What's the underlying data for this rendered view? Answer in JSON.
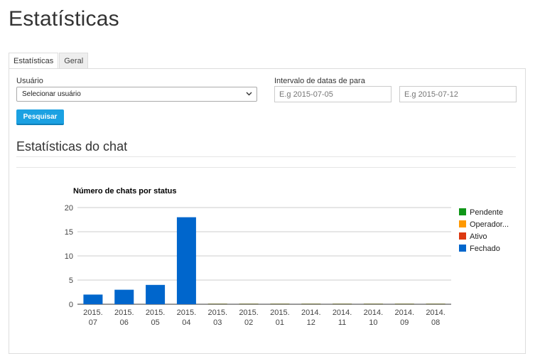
{
  "page": {
    "title": "Estatísticas"
  },
  "tabs": [
    {
      "label": "Estatísticas",
      "active": true
    },
    {
      "label": "Geral",
      "active": false
    }
  ],
  "form": {
    "user_label": "Usuário",
    "user_select_value": "Selecionar usuário",
    "date_range_label": "Intervalo de datas de para",
    "date_from_placeholder": "E.g 2015-07-05",
    "date_to_placeholder": "E.g 2015-07-12",
    "search_button": "Pesquisar"
  },
  "section": {
    "title": "Estatísticas do chat"
  },
  "colors": {
    "accent_button": "#1ba1e2",
    "pendente": "#109618",
    "operador": "#ff9900",
    "ativo": "#dc3912",
    "fechado": "#0066cc"
  },
  "chart_data": {
    "type": "bar",
    "title": "Número de chats por status",
    "categories": [
      [
        "2015.",
        "07"
      ],
      [
        "2015.",
        "06"
      ],
      [
        "2015.",
        "05"
      ],
      [
        "2015.",
        "04"
      ],
      [
        "2015.",
        "03"
      ],
      [
        "2015.",
        "02"
      ],
      [
        "2015.",
        "01"
      ],
      [
        "2014.",
        "12"
      ],
      [
        "2014.",
        "11"
      ],
      [
        "2014.",
        "10"
      ],
      [
        "2014.",
        "09"
      ],
      [
        "2014.",
        "08"
      ]
    ],
    "series": [
      {
        "name": "Pendente",
        "color": "#109618",
        "values": [
          0,
          0,
          0,
          0,
          0,
          0,
          0,
          0,
          0,
          0,
          0,
          0
        ]
      },
      {
        "name": "Operador...",
        "color": "#ff9900",
        "values": [
          0,
          0,
          0,
          0,
          0,
          0,
          0,
          0,
          0,
          0,
          0,
          0
        ]
      },
      {
        "name": "Ativo",
        "color": "#dc3912",
        "values": [
          0,
          0,
          0,
          0,
          0,
          0,
          0,
          0,
          0,
          0,
          0,
          0
        ]
      },
      {
        "name": "Fechado",
        "color": "#0066cc",
        "values": [
          2,
          3,
          4,
          18,
          0,
          0,
          0,
          0,
          0,
          0,
          0,
          0
        ]
      }
    ],
    "stacked": true,
    "yticks": [
      0,
      5,
      10,
      15,
      20
    ],
    "ylim": [
      0,
      20
    ],
    "grid": true,
    "legend_position": "right"
  }
}
